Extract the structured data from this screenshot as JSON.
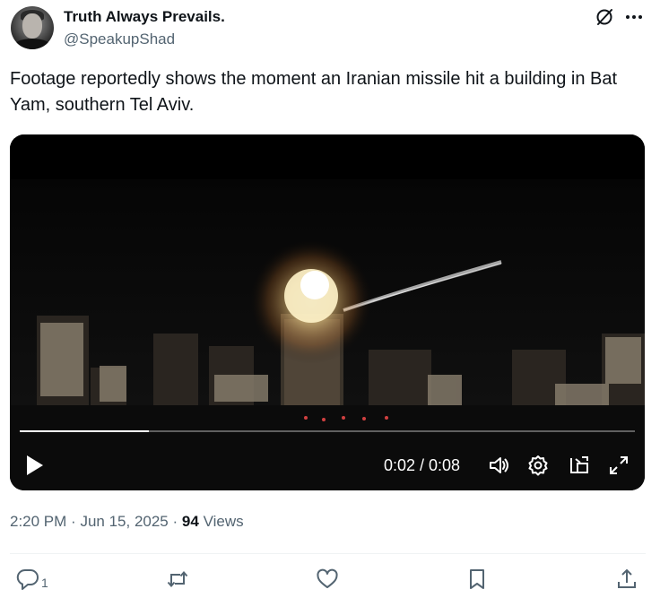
{
  "author": {
    "display_name": "Truth Always Prevails.",
    "handle": "@SpeakupShad"
  },
  "header_icons": [
    "grok-icon",
    "more-icon"
  ],
  "tweet": {
    "text": "Footage reportedly shows the moment an Iranian missile hit a building in Bat Yam, southern Tel Aviv."
  },
  "video": {
    "time_readout": "0:02 / 0:08",
    "progress_fraction": 0.21,
    "controls": [
      "play-icon",
      "volume-icon",
      "settings-gear-icon",
      "picture-in-picture-icon",
      "fullscreen-icon"
    ]
  },
  "meta": {
    "time": "2:20 PM",
    "separator": "·",
    "date": "Jun 15, 2025",
    "views_count": "94",
    "views_label": "Views"
  },
  "actions": {
    "reply_count": "1"
  },
  "colors": {
    "text_primary": "#0f1419",
    "text_secondary": "#536471",
    "divider": "#eff3f4"
  }
}
